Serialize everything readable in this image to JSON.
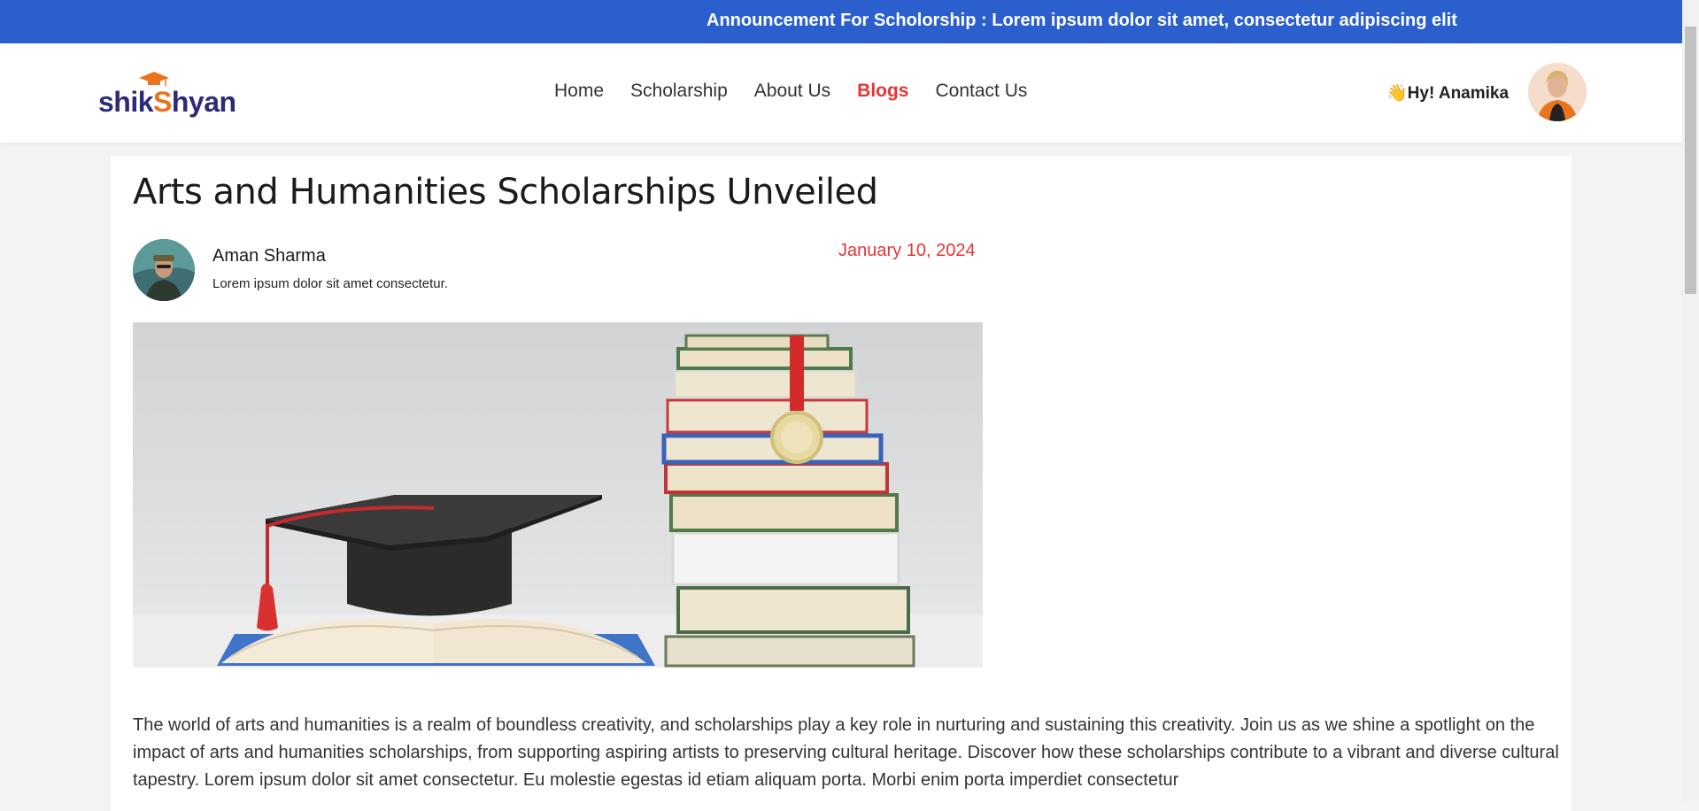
{
  "announcement": {
    "label": "Announcement For Scholorship : ",
    "message": "Lorem ipsum dolor sit amet, consectetur adipiscing elit"
  },
  "brand": {
    "logo_text_a": "shik",
    "logo_text_b": "hyan"
  },
  "nav": {
    "items": [
      {
        "label": "Home"
      },
      {
        "label": "Scholarship"
      },
      {
        "label": "About Us"
      },
      {
        "label": "Blogs"
      },
      {
        "label": "Contact Us"
      }
    ],
    "active": "Blogs"
  },
  "user": {
    "greeting": "👋Hy! Anamika"
  },
  "article": {
    "title": "Arts and Humanities Scholarships Unveiled",
    "author": {
      "name": "Aman Sharma",
      "subtitle": "Lorem ipsum dolor sit amet consectetur."
    },
    "date": "January 10, 2024",
    "body": "The world of arts and humanities is a realm of boundless creativity, and scholarships play a key role in nurturing and sustaining this creativity. Join us as we shine a spotlight on the impact of arts and humanities scholarships, from supporting aspiring artists to preserving cultural heritage. Discover how these scholarships contribute to a vibrant and diverse cultural tapestry. Lorem ipsum dolor sit amet consectetur. Eu molestie egestas id etiam aliquam porta. Morbi enim porta imperdiet consectetur"
  },
  "colors": {
    "announce_bg": "#2b5fce",
    "accent_red": "#e53535",
    "brand_navy": "#2d2a78",
    "brand_orange": "#e8741e"
  }
}
